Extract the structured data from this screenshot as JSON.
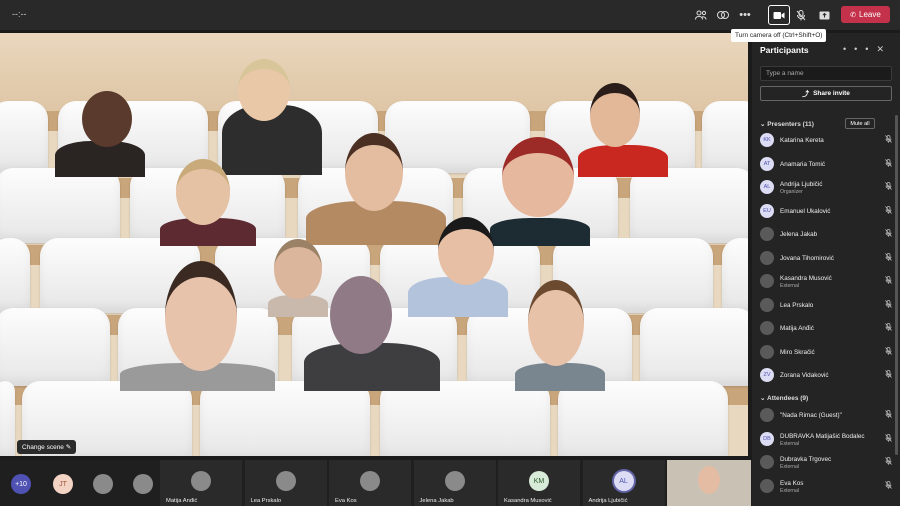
{
  "topbar": {
    "timer": "--:--",
    "leave_label": "Leave",
    "tooltip": "Turn camera off (Ctrl+Shift+O)",
    "icons": [
      "people-icon",
      "reactions-icon",
      "more-icon",
      "camera-icon",
      "mic-off-icon",
      "share-icon",
      "phone-icon"
    ]
  },
  "stage": {
    "change_scene": "Change scene"
  },
  "panel": {
    "title": "Participants",
    "search_placeholder": "Type a name",
    "share_invite": "Share invite",
    "presenters_header": "Presenters (11)",
    "mute_all": "Mute all",
    "attendees_header": "Attendees (9)",
    "presenters": [
      {
        "name": "Katarina Kereta",
        "initials": "KK",
        "sub": ""
      },
      {
        "name": "Anamaria Tomić",
        "initials": "AT",
        "sub": ""
      },
      {
        "name": "Andrija Ljubičić",
        "initials": "AL",
        "sub": "Organizer"
      },
      {
        "name": "Emanuel Ukalović",
        "initials": "EU",
        "sub": ""
      },
      {
        "name": "Jelena Jakab",
        "initials": "",
        "sub": ""
      },
      {
        "name": "Jovana Tihomirović",
        "initials": "",
        "sub": ""
      },
      {
        "name": "Kasandra Musović",
        "initials": "",
        "sub": "External"
      },
      {
        "name": "Lea Prskalo",
        "initials": "",
        "sub": ""
      },
      {
        "name": "Matija Anđić",
        "initials": "",
        "sub": ""
      },
      {
        "name": "Miro Skračić",
        "initials": "",
        "sub": ""
      },
      {
        "name": "Zorana Vidaković",
        "initials": "ZV",
        "sub": ""
      }
    ],
    "attendees": [
      {
        "name": "\"Nada Rimac (Guest)\"",
        "initials": "",
        "sub": ""
      },
      {
        "name": "DUBRAVKA Matijašić Bodalec",
        "initials": "DB",
        "sub": "External"
      },
      {
        "name": "Dubravka Trgovec",
        "initials": "",
        "sub": "External"
      },
      {
        "name": "Eva Kos",
        "initials": "",
        "sub": "External"
      }
    ]
  },
  "bottom": {
    "overflow": "+10",
    "tiles": [
      {
        "initials": "JT",
        "name": ""
      },
      {
        "initials": "",
        "name": ""
      },
      {
        "initials": "",
        "name": ""
      },
      {
        "initials": "",
        "name": "Matija Anđić"
      },
      {
        "initials": "",
        "name": "Lea Prskalo"
      },
      {
        "initials": "",
        "name": "Eva Kos"
      },
      {
        "initials": "",
        "name": "Jelena Jakab"
      },
      {
        "initials": "KM",
        "name": "Kasandra Musović"
      },
      {
        "initials": "AL",
        "name": "Andrija Ljubičić"
      },
      {
        "initials": "",
        "name": ""
      }
    ]
  },
  "colors": {
    "leave": "#c4314b",
    "panel": "#242424",
    "topbar": "#292929"
  }
}
